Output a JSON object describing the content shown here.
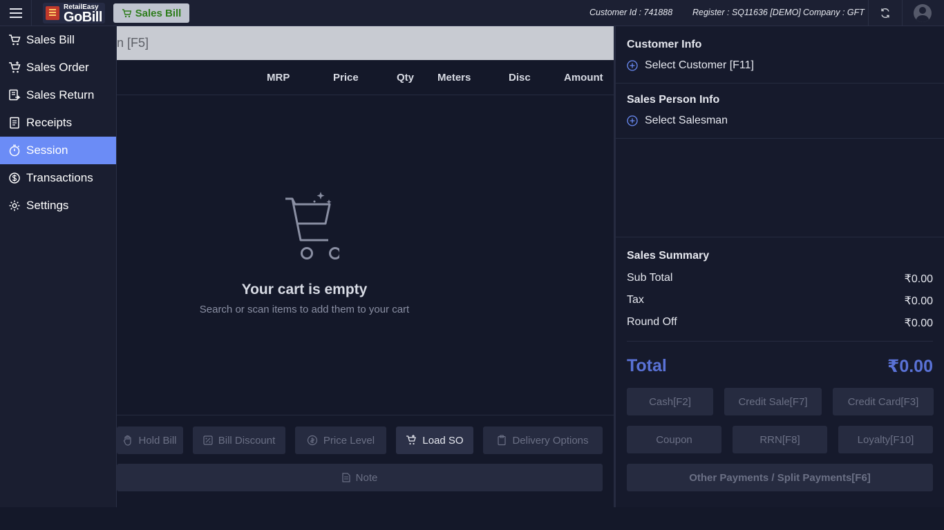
{
  "header": {
    "logo_small": "RetailEasy",
    "logo_big": "GoBill",
    "active_tab": "Sales Bill",
    "customer_id": "Customer Id : 741888",
    "register": "Register : SQ11636 [DEMO]",
    "company": "Company : GFT"
  },
  "sidebar": {
    "items": [
      {
        "label": "Sales Bill",
        "icon": "cart-icon"
      },
      {
        "label": "Sales Order",
        "icon": "cart-plus-icon"
      },
      {
        "label": "Sales Return",
        "icon": "return-icon"
      },
      {
        "label": "Receipts",
        "icon": "receipt-icon"
      },
      {
        "label": "Session",
        "icon": "stopwatch-icon",
        "active": true
      },
      {
        "label": "Transactions",
        "icon": "dollar-cycle-icon"
      },
      {
        "label": "Settings",
        "icon": "gear-icon"
      }
    ]
  },
  "search": {
    "placeholder": "n [F5]"
  },
  "cart": {
    "columns": [
      "MRP",
      "Price",
      "Qty",
      "Meters",
      "Disc",
      "Amount"
    ],
    "empty_title": "Your cart is empty",
    "empty_sub": "Search or scan items to add them to your cart"
  },
  "actions": {
    "hold_bill": "Hold Bill",
    "bill_discount": "Bill Discount",
    "price_level": "Price Level",
    "load_so": "Load SO",
    "delivery_options": "Delivery Options",
    "note": "Note"
  },
  "right": {
    "customer_title": "Customer Info",
    "select_customer": "Select Customer [F11]",
    "salesperson_title": "Sales Person Info",
    "select_salesman": "Select Salesman",
    "summary_title": "Sales Summary",
    "subtotal_label": "Sub Total",
    "subtotal_value": "₹0.00",
    "tax_label": "Tax",
    "tax_value": "₹0.00",
    "roundoff_label": "Round Off",
    "roundoff_value": "₹0.00",
    "total_label": "Total",
    "total_value": "₹0.00"
  },
  "payments": {
    "cash": "Cash[F2]",
    "credit_sale": "Credit Sale[F7]",
    "credit_card": "Credit Card[F3]",
    "coupon": "Coupon",
    "rrn": "RRN[F8]",
    "loyalty": "Loyalty[F10]",
    "other": "Other Payments / Split Payments[F6]"
  },
  "colors": {
    "accent": "#6b8cf6",
    "total": "#5a72d6",
    "tab_green": "#2e7d1c"
  }
}
